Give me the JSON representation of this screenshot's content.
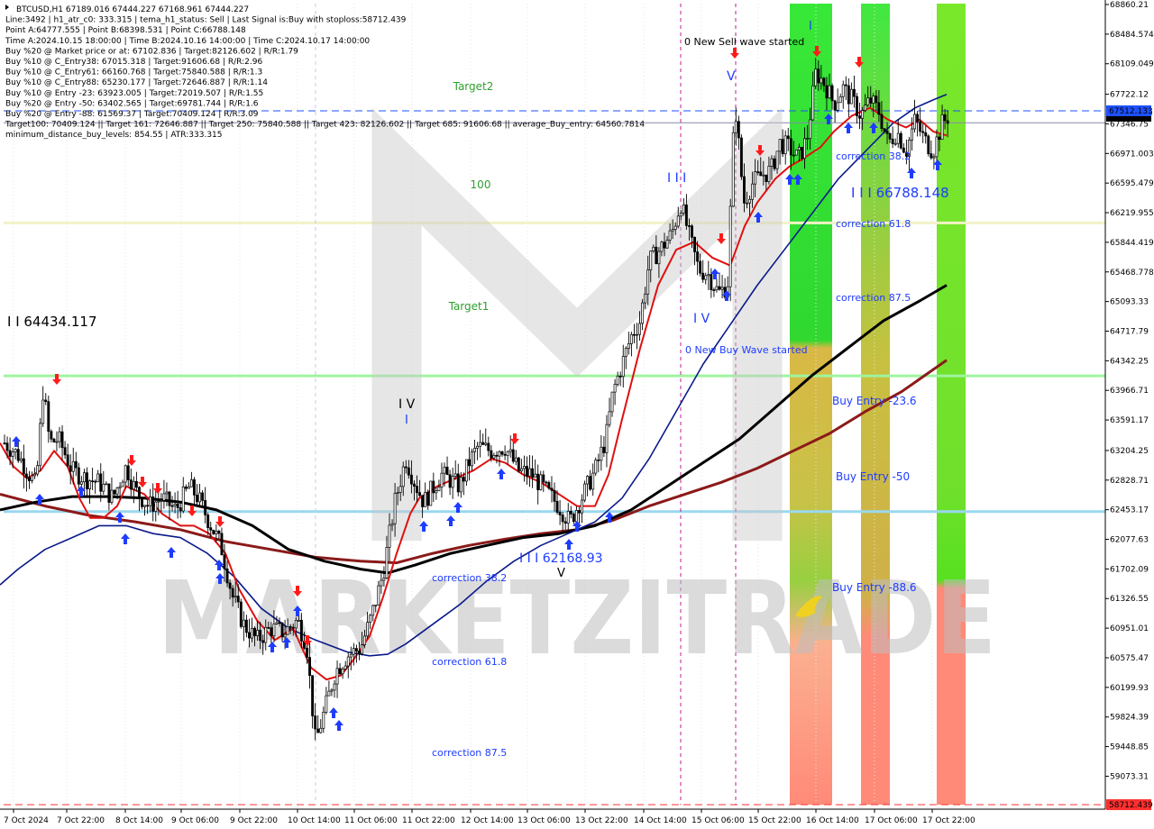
{
  "header": {
    "lines": [
      "BTCUSD,H1  67189.016 67444.227 67168.961 67444.227",
      "Line:3492 | h1_atr_c0: 333.315 | tema_h1_status: Sell | Last Signal is:Buy with stoploss:58712.439",
      "Point A:64777.555 | Point B:68398.531 | Point C:66788.148",
      "Time A:2024.10.15 18:00:00 | Time B:2024.10.16 14:00:00 | Time C:2024.10.17 14:00:00",
      "Buy %20 @ Market price or at: 67102.836 | Target:82126.602 | R/R:1.79",
      "Buy %10 @ C_Entry38: 67015.318 | Target:91606.68 | R/R:2.96",
      "Buy %10 @ C_Entry61: 66160.768 | Target:75840.588 | R/R:1.3",
      "Buy %10 @ C_Entry88: 65230.177 | Target:72646.887 | R/R:1.14",
      "Buy %10 @ Entry -23: 63923.005 | Target:72019.507 | R/R:1.55",
      "Buy %20 @ Entry -50: 63402.565 | Target:69781.744 | R/R:1.6",
      "Buy %20 @ Entry -88: 61569.37 | Target:70409.124 | R/R:3.09",
      "Target100: 70409.124 || Target 161: 72646.887 || Target 250: 75840.588 || Target 423: 82126.602 || Target 685: 91606.68 || average_Buy_entry: 64560.7814",
      "minimum_distance_buy_levels: 854.55 | ATR:333.315"
    ]
  },
  "watermark": "MARKETZITRADE",
  "chart_data": {
    "type": "candlestick",
    "symbol": "BTCUSD",
    "timeframe": "H1",
    "last_close": 67444.227,
    "ylim": [
      58712.439,
      68860.21
    ],
    "y_ticks": [
      68860.21,
      68484.574,
      68109.049,
      67722.12,
      67346.75,
      66971.003,
      66595.479,
      66219.955,
      65844.419,
      65468.778,
      65093.33,
      64717.79,
      64342.25,
      63966.71,
      63591.17,
      63204.25,
      62828.71,
      62453.17,
      62077.63,
      61702.09,
      61326.55,
      60951.01,
      60575.47,
      60199.93,
      59824.39,
      59448.85,
      59073.31
    ],
    "x_ticks": [
      "7 Oct 2024",
      "7 Oct 22:00",
      "8 Oct 14:00",
      "9 Oct 06:00",
      "9 Oct 22:00",
      "10 Oct 14:00",
      "11 Oct 06:00",
      "11 Oct 22:00",
      "12 Oct 14:00",
      "13 Oct 06:00",
      "13 Oct 22:00",
      "14 Oct 14:00",
      "15 Oct 06:00",
      "15 Oct 22:00",
      "16 Oct 14:00",
      "17 Oct 06:00",
      "17 Oct 22:00"
    ],
    "price_tags": [
      {
        "value": 67512.133,
        "label": "67512.133",
        "color": "#1e50ff"
      },
      {
        "value": 58712.439,
        "label": "58712.439",
        "color": "#ff3030"
      }
    ],
    "horizontal_levels": [
      {
        "value": 66090,
        "color": "#f2f2c8",
        "width": 3
      },
      {
        "value": 64150,
        "color": "#9ef59e",
        "width": 3
      },
      {
        "value": 62430,
        "color": "#9ad8ee",
        "width": 3
      },
      {
        "value": 67512.133,
        "color": "#1e50ff",
        "dash": true
      },
      {
        "value": 67360,
        "color": "#8888aa"
      },
      {
        "value": 58712.439,
        "color": "#ff3030",
        "dash": true
      }
    ],
    "annotations": [
      {
        "text": "Target2",
        "color": "#2ea02e",
        "size": 12
      },
      {
        "text": "100",
        "color": "#2ea02e",
        "size": 12
      },
      {
        "text": "Target1",
        "color": "#2ea02e",
        "size": 12
      },
      {
        "text": "I I 64434.117",
        "color": "#000000",
        "size": 15
      },
      {
        "text": "I V",
        "color": "#000000",
        "size": 14
      },
      {
        "text": "I",
        "color": "#1e3cff",
        "size": 13
      },
      {
        "text": "I I I 62168.93",
        "color": "#1e3cff",
        "size": 14
      },
      {
        "text": "V",
        "color": "#000000",
        "size": 13
      },
      {
        "text": "correction 38.2",
        "color": "#1e3cff",
        "size": 11
      },
      {
        "text": "correction 61.8",
        "color": "#1e3cff",
        "size": 11
      },
      {
        "text": "correction 87.5",
        "color": "#1e3cff",
        "size": 11
      },
      {
        "text": "0 New Sell wave started",
        "color": "#000000",
        "size": 11
      },
      {
        "text": "V",
        "color": "#1e3cff",
        "size": 14
      },
      {
        "text": "I I I",
        "color": "#1e3cff",
        "size": 14
      },
      {
        "text": "I V",
        "color": "#1e3cff",
        "size": 14
      },
      {
        "text": "0 New Buy Wave started",
        "color": "#1e3cff",
        "size": 11
      },
      {
        "text": "I",
        "color": "#1e3cff",
        "size": 13
      },
      {
        "text": "correction 38.2",
        "color": "#1e3cff",
        "size": 11
      },
      {
        "text": "I I I 66788.148",
        "color": "#1e3cff",
        "size": 15
      },
      {
        "text": "correction 61.8",
        "color": "#1e3cff",
        "size": 11
      },
      {
        "text": "correction 87.5",
        "color": "#1e3cff",
        "size": 11
      },
      {
        "text": "Buy Entry -23.6",
        "color": "#1e3cff",
        "size": 12
      },
      {
        "text": "Buy Entry -50",
        "color": "#1e3cff",
        "size": 12
      },
      {
        "text": "Buy Entry -88.6",
        "color": "#1e3cff",
        "size": 12
      }
    ],
    "colors": {
      "candle": "#000000",
      "ma_red": "#e01010",
      "ma_blue": "#0a1a8a",
      "ma_black": "#000000",
      "ma_darkred": "#8b1a1a",
      "buy_arrow": "#1e3cff",
      "sell_arrow": "#ff1a1a",
      "vline": "#c0189c"
    },
    "ma_red_path": [
      [
        0,
        63300
      ],
      [
        15,
        63000
      ],
      [
        30,
        62850
      ],
      [
        45,
        62950
      ],
      [
        60,
        63200
      ],
      [
        75,
        63000
      ],
      [
        88,
        62600
      ],
      [
        100,
        62350
      ],
      [
        115,
        62350
      ],
      [
        130,
        62500
      ],
      [
        140,
        62750
      ],
      [
        160,
        62650
      ],
      [
        180,
        62400
      ],
      [
        200,
        62250
      ],
      [
        215,
        62250
      ],
      [
        232,
        62150
      ],
      [
        250,
        61900
      ],
      [
        265,
        61450
      ],
      [
        285,
        61050
      ],
      [
        305,
        60800
      ],
      [
        325,
        60950
      ],
      [
        345,
        60450
      ],
      [
        362,
        60300
      ],
      [
        378,
        60350
      ],
      [
        392,
        60550
      ],
      [
        410,
        60850
      ],
      [
        425,
        61350
      ],
      [
        440,
        61900
      ],
      [
        455,
        62400
      ],
      [
        465,
        62600
      ],
      [
        485,
        62750
      ],
      [
        505,
        62850
      ],
      [
        525,
        62950
      ],
      [
        545,
        63100
      ],
      [
        560,
        63050
      ],
      [
        580,
        62900
      ],
      [
        600,
        62800
      ],
      [
        620,
        62650
      ],
      [
        640,
        62500
      ],
      [
        660,
        62500
      ],
      [
        675,
        62900
      ],
      [
        690,
        63600
      ],
      [
        710,
        64500
      ],
      [
        730,
        65300
      ],
      [
        750,
        65750
      ],
      [
        770,
        65850
      ],
      [
        790,
        65650
      ],
      [
        810,
        65550
      ],
      [
        826,
        66050
      ],
      [
        840,
        66350
      ],
      [
        860,
        66650
      ],
      [
        875,
        66800
      ],
      [
        890,
        66900
      ],
      [
        910,
        67050
      ],
      [
        925,
        67250
      ],
      [
        945,
        67450
      ],
      [
        965,
        67550
      ],
      [
        985,
        67400
      ],
      [
        1005,
        67300
      ],
      [
        1020,
        67400
      ],
      [
        1035,
        67250
      ],
      [
        1050,
        67200
      ]
    ],
    "ma_blue_path": [
      [
        0,
        61500
      ],
      [
        20,
        61700
      ],
      [
        50,
        61950
      ],
      [
        80,
        62100
      ],
      [
        110,
        62250
      ],
      [
        140,
        62250
      ],
      [
        170,
        62150
      ],
      [
        200,
        62100
      ],
      [
        230,
        61900
      ],
      [
        260,
        61600
      ],
      [
        290,
        61200
      ],
      [
        320,
        60950
      ],
      [
        350,
        60800
      ],
      [
        385,
        60650
      ],
      [
        410,
        60600
      ],
      [
        430,
        60620
      ],
      [
        450,
        60750
      ],
      [
        480,
        61000
      ],
      [
        510,
        61250
      ],
      [
        540,
        61550
      ],
      [
        570,
        61800
      ],
      [
        600,
        62000
      ],
      [
        630,
        62150
      ],
      [
        660,
        62300
      ],
      [
        690,
        62600
      ],
      [
        720,
        63100
      ],
      [
        750,
        63700
      ],
      [
        780,
        64300
      ],
      [
        810,
        64800
      ],
      [
        840,
        65300
      ],
      [
        870,
        65750
      ],
      [
        900,
        66200
      ],
      [
        930,
        66650
      ],
      [
        960,
        67000
      ],
      [
        990,
        67350
      ],
      [
        1015,
        67550
      ],
      [
        1035,
        67650
      ],
      [
        1050,
        67720
      ]
    ],
    "ma_black_path": [
      [
        0,
        62450
      ],
      [
        40,
        62550
      ],
      [
        80,
        62620
      ],
      [
        120,
        62620
      ],
      [
        160,
        62600
      ],
      [
        200,
        62550
      ],
      [
        240,
        62450
      ],
      [
        280,
        62250
      ],
      [
        320,
        61950
      ],
      [
        360,
        61800
      ],
      [
        400,
        61700
      ],
      [
        430,
        61650
      ],
      [
        460,
        61750
      ],
      [
        500,
        61900
      ],
      [
        540,
        62000
      ],
      [
        580,
        62100
      ],
      [
        620,
        62150
      ],
      [
        660,
        62250
      ],
      [
        700,
        62450
      ],
      [
        740,
        62750
      ],
      [
        780,
        63050
      ],
      [
        820,
        63350
      ],
      [
        860,
        63750
      ],
      [
        900,
        64150
      ],
      [
        940,
        64500
      ],
      [
        980,
        64850
      ],
      [
        1020,
        65100
      ],
      [
        1050,
        65300
      ]
    ],
    "ma_darkred_path": [
      [
        0,
        62650
      ],
      [
        50,
        62500
      ],
      [
        100,
        62380
      ],
      [
        150,
        62300
      ],
      [
        200,
        62200
      ],
      [
        250,
        62050
      ],
      [
        300,
        61950
      ],
      [
        350,
        61850
      ],
      [
        400,
        61800
      ],
      [
        440,
        61780
      ],
      [
        480,
        61900
      ],
      [
        520,
        62000
      ],
      [
        560,
        62080
      ],
      [
        600,
        62150
      ],
      [
        640,
        62200
      ],
      [
        680,
        62320
      ],
      [
        720,
        62500
      ],
      [
        760,
        62650
      ],
      [
        800,
        62800
      ],
      [
        840,
        62980
      ],
      [
        880,
        63200
      ],
      [
        920,
        63420
      ],
      [
        960,
        63700
      ],
      [
        1000,
        63950
      ],
      [
        1050,
        64350
      ]
    ],
    "candles_path": [
      [
        5,
        63300
      ],
      [
        20,
        63150
      ],
      [
        30,
        62950
      ],
      [
        40,
        62750
      ],
      [
        48,
        64000
      ],
      [
        55,
        63300
      ],
      [
        65,
        63350
      ],
      [
        80,
        62950
      ],
      [
        95,
        62850
      ],
      [
        110,
        62800
      ],
      [
        125,
        62600
      ],
      [
        140,
        63000
      ],
      [
        150,
        62700
      ],
      [
        165,
        62500
      ],
      [
        180,
        62600
      ],
      [
        195,
        62450
      ],
      [
        210,
        62750
      ],
      [
        220,
        62600
      ],
      [
        232,
        62300
      ],
      [
        245,
        62000
      ],
      [
        258,
        61350
      ],
      [
        270,
        61000
      ],
      [
        285,
        60800
      ],
      [
        300,
        60950
      ],
      [
        315,
        60900
      ],
      [
        330,
        61050
      ],
      [
        340,
        60750
      ],
      [
        350,
        59500
      ],
      [
        360,
        59900
      ],
      [
        372,
        60400
      ],
      [
        385,
        60600
      ],
      [
        400,
        60700
      ],
      [
        412,
        61100
      ],
      [
        425,
        61650
      ],
      [
        438,
        62550
      ],
      [
        450,
        63100
      ],
      [
        460,
        62800
      ],
      [
        470,
        62550
      ],
      [
        490,
        62900
      ],
      [
        510,
        62750
      ],
      [
        520,
        63050
      ],
      [
        530,
        63250
      ],
      [
        545,
        63200
      ],
      [
        560,
        63250
      ],
      [
        575,
        62950
      ],
      [
        590,
        62900
      ],
      [
        605,
        62700
      ],
      [
        620,
        62500
      ],
      [
        632,
        62300
      ],
      [
        645,
        62600
      ],
      [
        660,
        62950
      ],
      [
        672,
        63350
      ],
      [
        680,
        63950
      ],
      [
        690,
        64300
      ],
      [
        700,
        64650
      ],
      [
        710,
        64850
      ],
      [
        720,
        65600
      ],
      [
        732,
        65750
      ],
      [
        745,
        65950
      ],
      [
        755,
        66350
      ],
      [
        765,
        65900
      ],
      [
        775,
        65500
      ],
      [
        785,
        65450
      ],
      [
        797,
        65200
      ],
      [
        807,
        65300
      ],
      [
        815,
        67650
      ],
      [
        825,
        66350
      ],
      [
        835,
        66600
      ],
      [
        845,
        66700
      ],
      [
        855,
        66750
      ],
      [
        865,
        67100
      ],
      [
        875,
        67050
      ],
      [
        885,
        66900
      ],
      [
        895,
        67150
      ],
      [
        905,
        68000
      ],
      [
        915,
        67850
      ],
      [
        925,
        67600
      ],
      [
        935,
        67800
      ],
      [
        945,
        67650
      ],
      [
        955,
        67450
      ],
      [
        965,
        67650
      ],
      [
        975,
        67500
      ],
      [
        985,
        67100
      ],
      [
        995,
        67250
      ],
      [
        1005,
        67000
      ],
      [
        1015,
        67400
      ],
      [
        1025,
        67150
      ],
      [
        1035,
        67000
      ],
      [
        1045,
        67350
      ],
      [
        1052,
        67444
      ]
    ]
  }
}
